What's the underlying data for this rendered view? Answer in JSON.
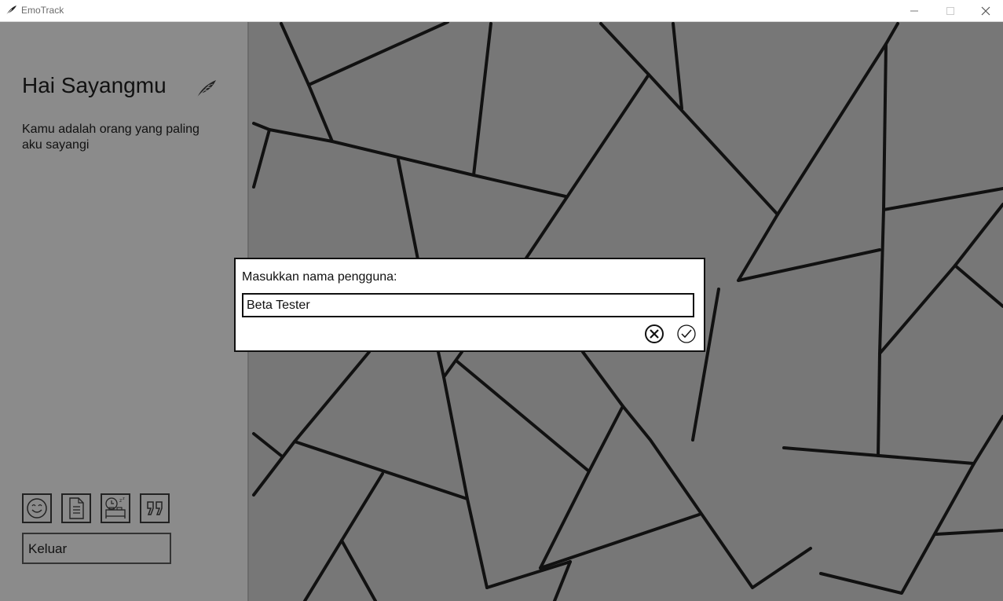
{
  "window": {
    "title": "EmoTrack",
    "controls": [
      "minimize-icon",
      "maximize-icon",
      "close-icon"
    ]
  },
  "sidebar": {
    "greeting": "Hai Sayangmu",
    "greeting_icon": "feather-icon",
    "subtitle": "Kamu adalah orang yang paling aku sayangi",
    "nav_icons": [
      "smiley-icon",
      "document-icon",
      "sleep-icon",
      "quote-icon"
    ],
    "logout_label": "Keluar"
  },
  "dialog": {
    "label": "Masukkan nama pengguna:",
    "input_value": "Beta Tester",
    "cancel_icon": "cancel-circle-icon",
    "confirm_icon": "check-circle-icon"
  },
  "colors": {
    "sidebar_bg": "#8b8b8b",
    "canvas_bg": "#777777",
    "line_color": "#111111",
    "dialog_bg": "#ffffff"
  }
}
